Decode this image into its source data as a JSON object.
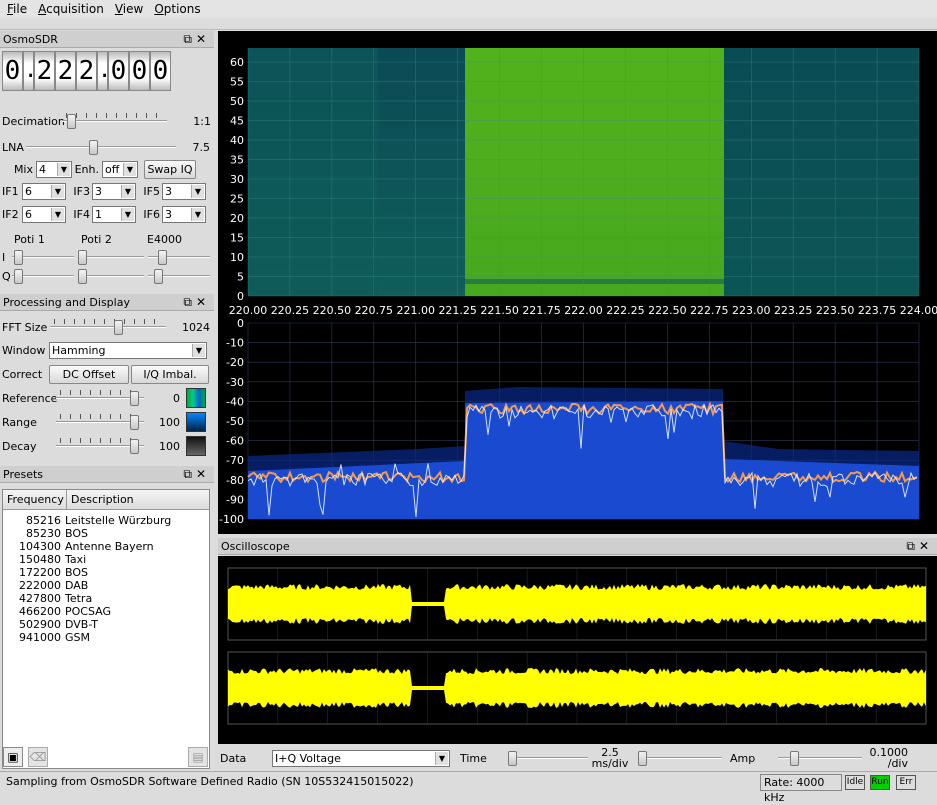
{
  "menu": [
    {
      "label": "File",
      "key": "F",
      "rest": "ile"
    },
    {
      "label": "Acquisition",
      "key": "A",
      "rest": "cquisition"
    },
    {
      "label": "View",
      "key": "V",
      "rest": "iew"
    },
    {
      "label": "Options",
      "key": "O",
      "rest": "ptions"
    }
  ],
  "osmo": {
    "title": "OsmoSDR",
    "frequency_digits": [
      "0",
      ".",
      "2",
      "2",
      "2",
      ".",
      "0",
      "0",
      "0"
    ],
    "decimation": {
      "label": "Decimation",
      "value": "1:1",
      "level": 0.05
    },
    "lna": {
      "label": "LNA",
      "value": "7.5",
      "level": 0.45
    },
    "mix": {
      "label": "Mix",
      "value": "4"
    },
    "enh": {
      "label": "Enh.",
      "value": "off"
    },
    "swap_label": "Swap IQ",
    "if_rows": [
      [
        {
          "label": "IF1",
          "value": "6"
        },
        {
          "label": "IF3",
          "value": "3"
        },
        {
          "label": "IF5",
          "value": "3"
        }
      ],
      [
        {
          "label": "IF2",
          "value": "6"
        },
        {
          "label": "IF4",
          "value": "1"
        },
        {
          "label": "IF6",
          "value": "3"
        }
      ]
    ],
    "poti_labels": [
      "Poti 1",
      "Poti 2",
      "E4000"
    ],
    "iq_labels": [
      "I",
      "Q"
    ]
  },
  "processing": {
    "title": "Processing and Display",
    "fft": {
      "label": "FFT Size",
      "value": "1024",
      "level": 0.6
    },
    "window": {
      "label": "Window",
      "value": "Hamming"
    },
    "correct_label": "Correct",
    "dc_label": "DC Offset",
    "iq_label": "I/Q Imbal.",
    "reference": {
      "label": "Reference",
      "value": "0",
      "level": 0.95
    },
    "range": {
      "label": "Range",
      "value": "100",
      "level": 0.95
    },
    "decay": {
      "label": "Decay",
      "value": "100",
      "level": 0.95
    }
  },
  "presets": {
    "title": "Presets",
    "columns": [
      "Frequency",
      "Description"
    ],
    "rows": [
      {
        "freq": "85216",
        "desc": "Leitstelle Würzburg"
      },
      {
        "freq": "85230",
        "desc": "BOS"
      },
      {
        "freq": "104300",
        "desc": "Antenne Bayern"
      },
      {
        "freq": "150480",
        "desc": "Taxi"
      },
      {
        "freq": "172200",
        "desc": "BOS"
      },
      {
        "freq": "222000",
        "desc": "DAB"
      },
      {
        "freq": "427800",
        "desc": "Tetra"
      },
      {
        "freq": "466200",
        "desc": "POCSAG"
      },
      {
        "freq": "502900",
        "desc": "DVB-T"
      },
      {
        "freq": "941000",
        "desc": "GSM"
      }
    ]
  },
  "waterfall": {
    "y_ticks": [
      "60",
      "55",
      "50",
      "45",
      "40",
      "35",
      "30",
      "25",
      "20",
      "15",
      "10",
      "5",
      "0"
    ],
    "x_ticks": [
      "220.00",
      "220.25",
      "220.50",
      "220.75",
      "221.00",
      "221.25",
      "221.50",
      "221.75",
      "222.00",
      "222.25",
      "222.50",
      "222.75",
      "223.00",
      "223.25",
      "223.50",
      "223.75",
      "224.00"
    ]
  },
  "spectrum": {
    "y_ticks": [
      "0",
      "-10",
      "-20",
      "-30",
      "-40",
      "-50",
      "-60",
      "-70",
      "-80",
      "-90",
      "-100"
    ]
  },
  "scope": {
    "title": "Oscilloscope",
    "data_label": "Data",
    "data_value": "I+Q Voltage",
    "time_label": "Time",
    "time_value": "2.5",
    "time_unit": "ms/div",
    "amp_label": "Amp",
    "amp_value": "0.1000",
    "amp_unit": "/div"
  },
  "status": {
    "message": "Sampling from OsmoSDR Software Defined Radio (SN  10S532415015022)",
    "rate": "Rate: 4000 kHz",
    "idle": "Idle",
    "run": "Run",
    "err": "Err"
  },
  "colors": {
    "waterfall_band": "#5cc21a",
    "waterfall_bg": "#0d5a5a",
    "scope_trace": "#ffff00",
    "run_green": "#00d000"
  }
}
